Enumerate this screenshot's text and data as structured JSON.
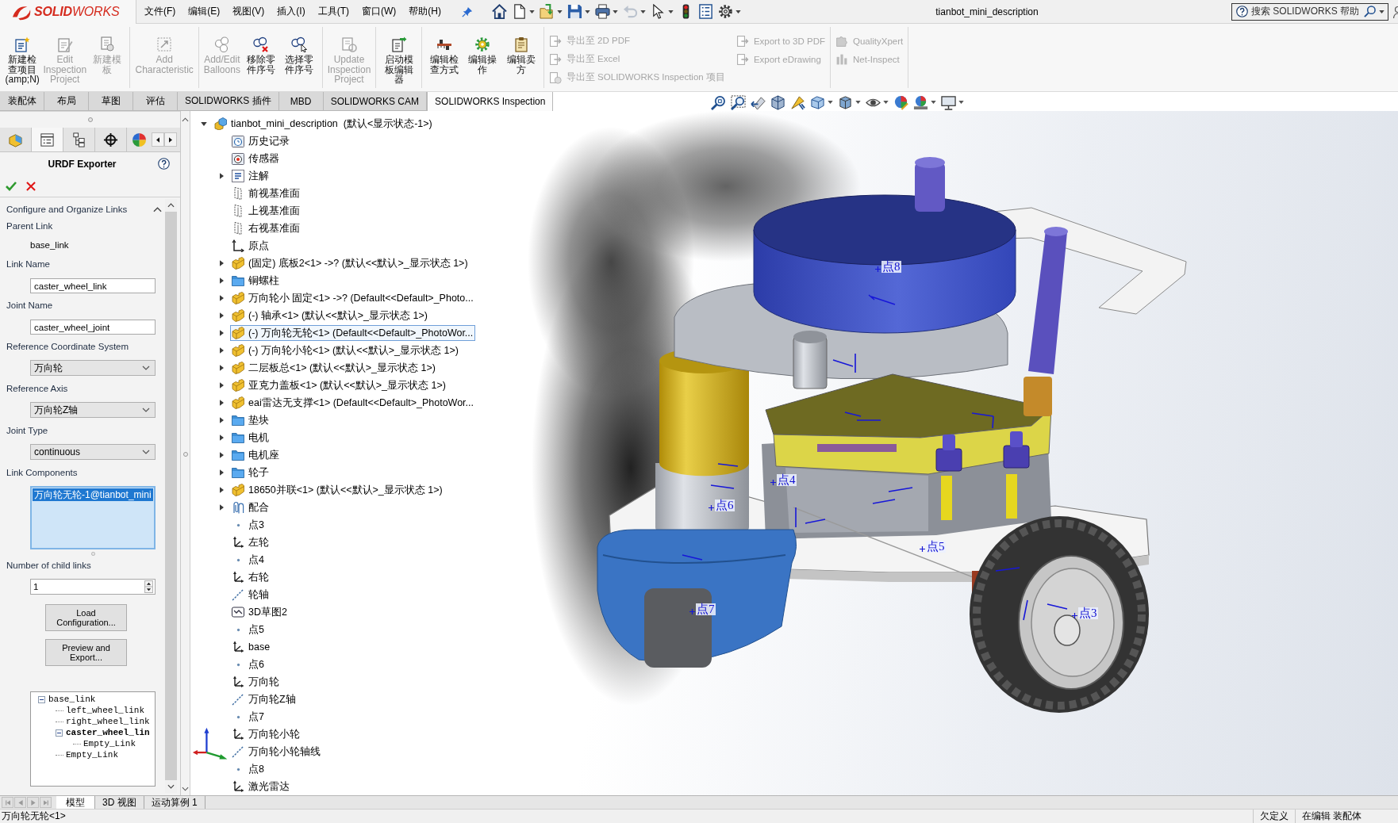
{
  "app": {
    "logo": "**SOLID**WORKS"
  },
  "menu": [
    "文件(F)",
    "编辑(E)",
    "视图(V)",
    "插入(I)",
    "工具(T)",
    "窗口(W)",
    "帮助(H)"
  ],
  "quick_access": [
    {
      "kind": "home",
      "dropdown": false,
      "disabled": false
    },
    {
      "kind": "new",
      "dropdown": true,
      "disabled": false
    },
    {
      "kind": "open",
      "dropdown": true,
      "disabled": false
    },
    {
      "kind": "save",
      "dropdown": true,
      "disabled": false
    },
    {
      "kind": "print",
      "dropdown": true,
      "disabled": false
    },
    {
      "kind": "undo",
      "dropdown": true,
      "disabled": true
    },
    {
      "kind": "select",
      "dropdown": true,
      "disabled": false
    },
    {
      "kind": "rebuild",
      "dropdown": false,
      "disabled": false
    },
    {
      "kind": "file-properties",
      "dropdown": false,
      "disabled": false
    },
    {
      "kind": "options",
      "dropdown": true,
      "disabled": false
    }
  ],
  "window": {
    "title": "tianbot_mini_description"
  },
  "help_search": {
    "placeholder": "搜索 SOLIDWORKS 帮助"
  },
  "ribbon": {
    "groups": [
      {
        "kind": "large",
        "buttons": [
          {
            "kind": "new-project",
            "label": "新建检查项目(amp;N)",
            "disabled": false
          },
          {
            "kind": "edit-project",
            "label": "Edit Inspection Project",
            "disabled": true
          },
          {
            "kind": "new-template",
            "label": "新建模板",
            "disabled": true
          }
        ]
      },
      {
        "kind": "large",
        "buttons": [
          {
            "kind": "add-characteristic",
            "label": "Add Characteristic",
            "disabled": true
          }
        ]
      },
      {
        "kind": "large",
        "buttons": [
          {
            "kind": "balloons",
            "label": "Add/Edit Balloons",
            "disabled": true
          },
          {
            "kind": "remove-balloons",
            "label": "移除零件序号",
            "disabled": false
          },
          {
            "kind": "select-balloons",
            "label": "选择零件序号",
            "disabled": false
          }
        ]
      },
      {
        "kind": "large",
        "buttons": [
          {
            "kind": "update-project",
            "label": "Update Inspection Project",
            "disabled": true
          }
        ]
      },
      {
        "kind": "large",
        "buttons": [
          {
            "kind": "template-editor",
            "label": "启动模板编辑器",
            "disabled": false
          }
        ]
      },
      {
        "kind": "large",
        "buttons": [
          {
            "kind": "inspection-method",
            "label": "编辑检查方式",
            "disabled": false
          },
          {
            "kind": "operations",
            "label": "编辑操作",
            "disabled": false
          },
          {
            "kind": "vendor",
            "label": "编辑卖方",
            "disabled": false
          }
        ]
      },
      {
        "kind": "small",
        "buttons": [
          {
            "kind": "export",
            "label": "导出至 2D PDF",
            "disabled": true
          },
          {
            "kind": "export",
            "label": "导出至 Excel",
            "disabled": true
          },
          {
            "kind": "export-project",
            "label": "导出至 SOLIDWORKS Inspection 项目",
            "disabled": true
          },
          {
            "kind": "export",
            "label": "Export to 3D PDF",
            "disabled": true
          },
          {
            "kind": "export",
            "label": "Export eDrawing",
            "disabled": true
          }
        ]
      },
      {
        "kind": "small",
        "buttons": [
          {
            "kind": "quality",
            "label": "QualityXpert",
            "disabled": true
          },
          {
            "kind": "net-inspect",
            "label": "Net-Inspect",
            "disabled": true
          }
        ]
      }
    ]
  },
  "command_tabs": [
    {
      "label": "装配体",
      "selected": false
    },
    {
      "label": "布局",
      "selected": false
    },
    {
      "label": "草图",
      "selected": false
    },
    {
      "label": "评估",
      "selected": false
    },
    {
      "label": "SOLIDWORKS 插件",
      "selected": false
    },
    {
      "label": "MBD",
      "selected": false
    },
    {
      "label": "SOLIDWORKS CAM",
      "selected": false
    },
    {
      "label": "SOLIDWORKS Inspection",
      "selected": true
    }
  ],
  "view_toolbar": [
    {
      "kind": "zoom-to-fit",
      "dropdown": false
    },
    {
      "kind": "zoom-to-area",
      "dropdown": false
    },
    {
      "kind": "previous-view",
      "dropdown": false
    },
    {
      "kind": "section-view",
      "dropdown": false
    },
    {
      "kind": "dynamic-annotation",
      "dropdown": false
    },
    {
      "kind": "view-orientation",
      "dropdown": true
    },
    {
      "kind": "display-style",
      "dropdown": true
    },
    {
      "kind": "hide-show",
      "dropdown": true
    },
    {
      "kind": "edit-appearance",
      "dropdown": false
    },
    {
      "kind": "apply-scene",
      "dropdown": true
    },
    {
      "kind": "view-settings",
      "dropdown": true
    }
  ],
  "property_manager": {
    "tabs": [
      {
        "kind": "feature-manager",
        "selected": false
      },
      {
        "kind": "property-manager",
        "selected": true
      },
      {
        "kind": "configuration-manager",
        "selected": false
      },
      {
        "kind": "dimxpert",
        "selected": false
      },
      {
        "kind": "display-manager",
        "selected": false
      }
    ],
    "title": "URDF Exporter",
    "section": {
      "title": "Configure and Organize Links",
      "expanded": true
    },
    "fields": [
      {
        "kind": "static",
        "label": "Parent Link",
        "value": "base_link"
      },
      {
        "kind": "text",
        "label": "Link Name",
        "value": "caster_wheel_link"
      },
      {
        "kind": "text",
        "label": "Joint Name",
        "value": "caster_wheel_joint"
      },
      {
        "kind": "select",
        "label": "Reference Coordinate System",
        "value": "万向轮"
      },
      {
        "kind": "select",
        "label": "Reference Axis",
        "value": "万向轮Z轴"
      },
      {
        "kind": "select",
        "label": "Joint Type",
        "value": "continuous"
      },
      {
        "kind": "list",
        "label": "Link Components",
        "items": [
          {
            "text": "万向轮无轮-1@tianbot_mini",
            "selected": true
          }
        ]
      },
      {
        "kind": "spinner",
        "label": "Number of child links",
        "value": "1"
      }
    ],
    "buttons": [
      "Load Configuration...",
      "Preview and Export..."
    ],
    "link_tree": [
      {
        "label": "base_link",
        "expanded": true,
        "selected": false,
        "children": [
          {
            "label": "left_wheel_link",
            "selected": false
          },
          {
            "label": "right_wheel_link",
            "selected": false
          },
          {
            "label": "caster_wheel_lin",
            "expanded": true,
            "selected": true,
            "children": [
              {
                "label": "Empty_Link",
                "selected": false
              }
            ]
          },
          {
            "label": "Empty_Link",
            "selected": false
          }
        ]
      }
    ]
  },
  "feature_tree": {
    "items": [
      {
        "kind": "assembly",
        "label": "tianbot_mini_description  (默认<显示状态-1>)",
        "expanded": true,
        "selected": false,
        "children": [
          {
            "kind": "history",
            "label": "历史记录",
            "selected": false
          },
          {
            "kind": "sensor",
            "label": "传感器",
            "selected": false
          },
          {
            "kind": "annotation",
            "label": "注解",
            "expanded": false,
            "selected": false
          },
          {
            "kind": "plane",
            "label": "前视基准面",
            "selected": false
          },
          {
            "kind": "plane",
            "label": "上视基准面",
            "selected": false
          },
          {
            "kind": "plane",
            "label": "右视基准面",
            "selected": false
          },
          {
            "kind": "origin",
            "label": "原点",
            "selected": false
          },
          {
            "kind": "part",
            "label": "(固定) 底板2<1> ->? (默认<<默认>_显示状态 1>)",
            "expanded": false,
            "selected": false
          },
          {
            "kind": "folder",
            "label": "铜螺柱",
            "expanded": false,
            "selected": false
          },
          {
            "kind": "part",
            "label": "万向轮小 固定<1> ->? (Default<<Default>_Photo...",
            "expanded": false,
            "selected": false
          },
          {
            "kind": "part",
            "label": "(-) 轴承<1> (默认<<默认>_显示状态 1>)",
            "expanded": false,
            "selected": false
          },
          {
            "kind": "part",
            "label": "(-) 万向轮无轮<1> (Default<<Default>_PhotoWor...",
            "expanded": false,
            "selected": true
          },
          {
            "kind": "part",
            "label": "(-) 万向轮小轮<1> (默认<<默认>_显示状态 1>)",
            "expanded": false,
            "selected": false
          },
          {
            "kind": "part",
            "label": "二层板总<1> (默认<<默认>_显示状态 1>)",
            "expanded": false,
            "selected": false
          },
          {
            "kind": "part",
            "label": "亚克力盖板<1> (默认<<默认>_显示状态 1>)",
            "expanded": false,
            "selected": false
          },
          {
            "kind": "part",
            "label": "eai雷达无支撑<1> (Default<<Default>_PhotoWor...",
            "expanded": false,
            "selected": false
          },
          {
            "kind": "folder",
            "label": "垫块",
            "expanded": false,
            "selected": false
          },
          {
            "kind": "folder",
            "label": "电机",
            "expanded": false,
            "selected": false
          },
          {
            "kind": "folder",
            "label": "电机座",
            "expanded": false,
            "selected": false
          },
          {
            "kind": "folder",
            "label": "轮子",
            "expanded": false,
            "selected": false
          },
          {
            "kind": "part",
            "label": "18650并联<1> (默认<<默认>_显示状态 1>)",
            "expanded": false,
            "selected": false
          },
          {
            "kind": "mates",
            "label": "配合",
            "expanded": false,
            "selected": false
          },
          {
            "kind": "point",
            "label": "点3",
            "selected": false
          },
          {
            "kind": "coordinate-system",
            "label": "左轮",
            "selected": false
          },
          {
            "kind": "point",
            "label": "点4",
            "selected": false
          },
          {
            "kind": "coordinate-system",
            "label": "右轮",
            "selected": false
          },
          {
            "kind": "axis",
            "label": "轮轴",
            "selected": false
          },
          {
            "kind": "sketch-3d",
            "label": "3D草图2",
            "selected": false
          },
          {
            "kind": "point",
            "label": "点5",
            "selected": false
          },
          {
            "kind": "coordinate-system",
            "label": "base",
            "selected": false
          },
          {
            "kind": "point",
            "label": "点6",
            "selected": false
          },
          {
            "kind": "coordinate-system",
            "label": "万向轮",
            "selected": false
          },
          {
            "kind": "axis",
            "label": "万向轮Z轴",
            "selected": false
          },
          {
            "kind": "point",
            "label": "点7",
            "selected": false
          },
          {
            "kind": "coordinate-system",
            "label": "万向轮小轮",
            "selected": false
          },
          {
            "kind": "axis",
            "label": "万向轮小轮轴线",
            "selected": false
          },
          {
            "kind": "point",
            "label": "点8",
            "selected": false
          },
          {
            "kind": "coordinate-system",
            "label": "激光雷达",
            "selected": false
          }
        ]
      }
    ]
  },
  "viewport": {
    "point_labels": [
      "点8",
      "点4",
      "点6",
      "点5",
      "点7",
      "点3"
    ]
  },
  "bottom_tabs": [
    {
      "label": "模型",
      "selected": true
    },
    {
      "label": "3D 视图",
      "selected": false
    },
    {
      "label": "运动算例 1",
      "selected": false
    }
  ],
  "status_bar": {
    "message": "万向轮无轮<1>",
    "definition": "欠定义",
    "mode": "在编辑 装配体"
  }
}
